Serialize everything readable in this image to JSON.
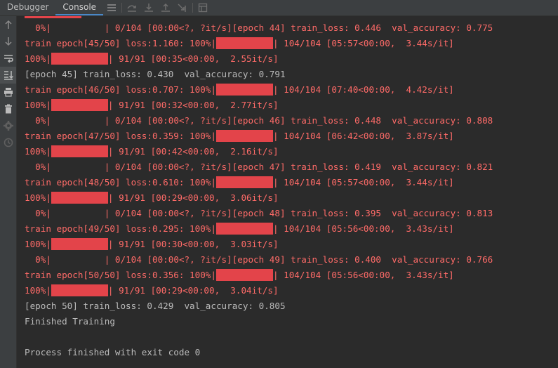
{
  "tabs": [
    {
      "label": "Debugger",
      "active": false
    },
    {
      "label": "Console",
      "active": true
    }
  ],
  "toolbar_icons": [
    "threads-icon",
    "step-over-icon",
    "step-into-icon",
    "step-out-icon",
    "run-to-cursor-icon",
    "evaluate-icon"
  ],
  "sidebar_icons": [
    "arrow-up-icon",
    "arrow-down-icon",
    "soft-wrap-icon",
    "scroll-to-end-icon",
    "print-icon",
    "trash-icon",
    "settings-icon",
    "history-icon"
  ],
  "colors": {
    "stderr": "#ff6b68",
    "stdout": "#bbbbbb",
    "progress_fill": "#e3444a",
    "background": "#2b2b2b"
  },
  "console": {
    "lines": [
      {
        "type": "stderr",
        "pre": "",
        "bar": true,
        "post": ""
      },
      {
        "type": "stderr",
        "pre": "  0%|",
        "bar": false,
        "pad": "          ",
        "post": "| 0/104 [00:00<?, ?it/s][epoch 44] train_loss: 0.446  val_accuracy: 0.775"
      },
      {
        "type": "stderr",
        "pre": "train epoch[45/50] loss:1.160: 100%|",
        "bar": true,
        "post": "| 104/104 [05:57<00:00,  3.44s/it]"
      },
      {
        "type": "stderr",
        "pre": "100%|",
        "bar": true,
        "post": "| 91/91 [00:35<00:00,  2.55it/s]"
      },
      {
        "type": "stdout",
        "pre": "[epoch 45] train_loss: 0.430  val_accuracy: 0.791",
        "bar": false,
        "post": ""
      },
      {
        "type": "stderr",
        "pre": "train epoch[46/50] loss:0.707: 100%|",
        "bar": true,
        "post": "| 104/104 [07:40<00:00,  4.42s/it]"
      },
      {
        "type": "stderr",
        "pre": "100%|",
        "bar": true,
        "post": "| 91/91 [00:32<00:00,  2.77it/s]"
      },
      {
        "type": "stderr",
        "pre": "  0%|",
        "bar": false,
        "pad": "          ",
        "post": "| 0/104 [00:00<?, ?it/s][epoch 46] train_loss: 0.448  val_accuracy: 0.808"
      },
      {
        "type": "stderr",
        "pre": "train epoch[47/50] loss:0.359: 100%|",
        "bar": true,
        "post": "| 104/104 [06:42<00:00,  3.87s/it]"
      },
      {
        "type": "stderr",
        "pre": "100%|",
        "bar": true,
        "post": "| 91/91 [00:42<00:00,  2.16it/s]"
      },
      {
        "type": "stderr",
        "pre": "  0%|",
        "bar": false,
        "pad": "          ",
        "post": "| 0/104 [00:00<?, ?it/s][epoch 47] train_loss: 0.419  val_accuracy: 0.821"
      },
      {
        "type": "stderr",
        "pre": "train epoch[48/50] loss:0.610: 100%|",
        "bar": true,
        "post": "| 104/104 [05:57<00:00,  3.44s/it]"
      },
      {
        "type": "stderr",
        "pre": "100%|",
        "bar": true,
        "post": "| 91/91 [00:29<00:00,  3.06it/s]"
      },
      {
        "type": "stderr",
        "pre": "  0%|",
        "bar": false,
        "pad": "          ",
        "post": "| 0/104 [00:00<?, ?it/s][epoch 48] train_loss: 0.395  val_accuracy: 0.813"
      },
      {
        "type": "stderr",
        "pre": "train epoch[49/50] loss:0.295: 100%|",
        "bar": true,
        "post": "| 104/104 [05:56<00:00,  3.43s/it]"
      },
      {
        "type": "stderr",
        "pre": "100%|",
        "bar": true,
        "post": "| 91/91 [00:30<00:00,  3.03it/s]"
      },
      {
        "type": "stderr",
        "pre": "  0%|",
        "bar": false,
        "pad": "          ",
        "post": "| 0/104 [00:00<?, ?it/s][epoch 49] train_loss: 0.400  val_accuracy: 0.766"
      },
      {
        "type": "stderr",
        "pre": "train epoch[50/50] loss:0.356: 100%|",
        "bar": true,
        "post": "| 104/104 [05:56<00:00,  3.43s/it]"
      },
      {
        "type": "stderr",
        "pre": "100%|",
        "bar": true,
        "post": "| 91/91 [00:29<00:00,  3.04it/s]"
      },
      {
        "type": "stdout",
        "pre": "[epoch 50] train_loss: 0.429  val_accuracy: 0.805",
        "bar": false,
        "post": ""
      },
      {
        "type": "stdout",
        "pre": "Finished Training",
        "bar": false,
        "post": ""
      },
      {
        "type": "stdout",
        "pre": "",
        "bar": false,
        "post": ""
      },
      {
        "type": "stdout",
        "pre": "Process finished with exit code 0",
        "bar": false,
        "post": ""
      }
    ]
  }
}
